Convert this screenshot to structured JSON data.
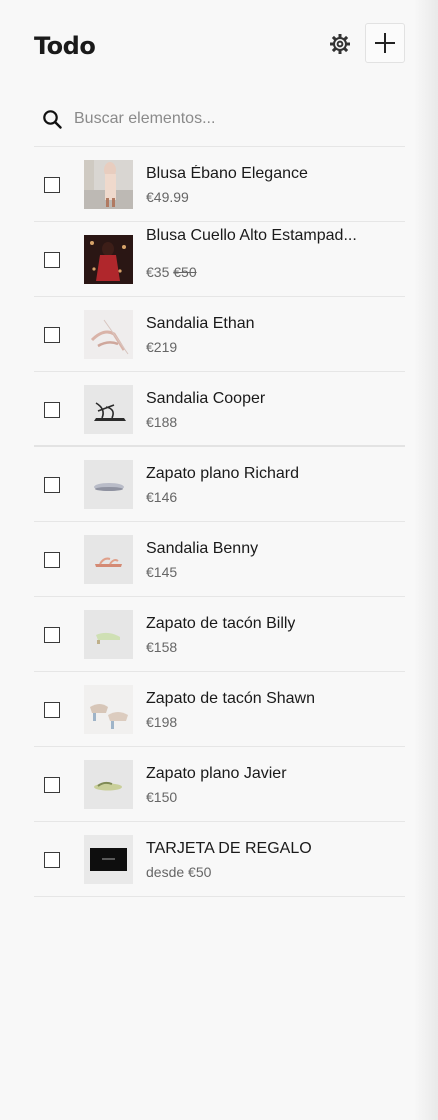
{
  "header": {
    "title": "Todo",
    "settings_icon": "gear-icon",
    "add_icon": "plus-icon"
  },
  "search": {
    "placeholder": "Buscar elementos..."
  },
  "items": [
    {
      "name": "Blusa Ébano Elegance",
      "price": "€49.99",
      "image": "woman-walking-photo"
    },
    {
      "name": "Blusa Cuello Alto Estampad...",
      "price": "€35",
      "old_price": "€50",
      "image": "woman-red-dress-photo"
    },
    {
      "name": "Sandalia Ethan",
      "price": "€219",
      "image": "pink-sandal-photo"
    },
    {
      "name": "Sandalia Cooper",
      "price": "€188",
      "image": "black-strappy-sandal-photo"
    },
    {
      "name": "Zapato plano Richard",
      "price": "€146",
      "image": "grey-flat-shoe-photo"
    },
    {
      "name": "Sandalia Benny",
      "price": "€145",
      "image": "pink-sandal-side-photo"
    },
    {
      "name": "Zapato de tacón Billy",
      "price": "€158",
      "image": "green-heel-photo"
    },
    {
      "name": "Zapato de tacón Shawn",
      "price": "€198",
      "image": "beige-heels-photo"
    },
    {
      "name": "Zapato plano Javier",
      "price": "€150",
      "image": "olive-flat-shoe-photo"
    },
    {
      "name": "TARJETA DE REGALO",
      "price": "desde €50",
      "image": "gift-card-photo"
    }
  ]
}
